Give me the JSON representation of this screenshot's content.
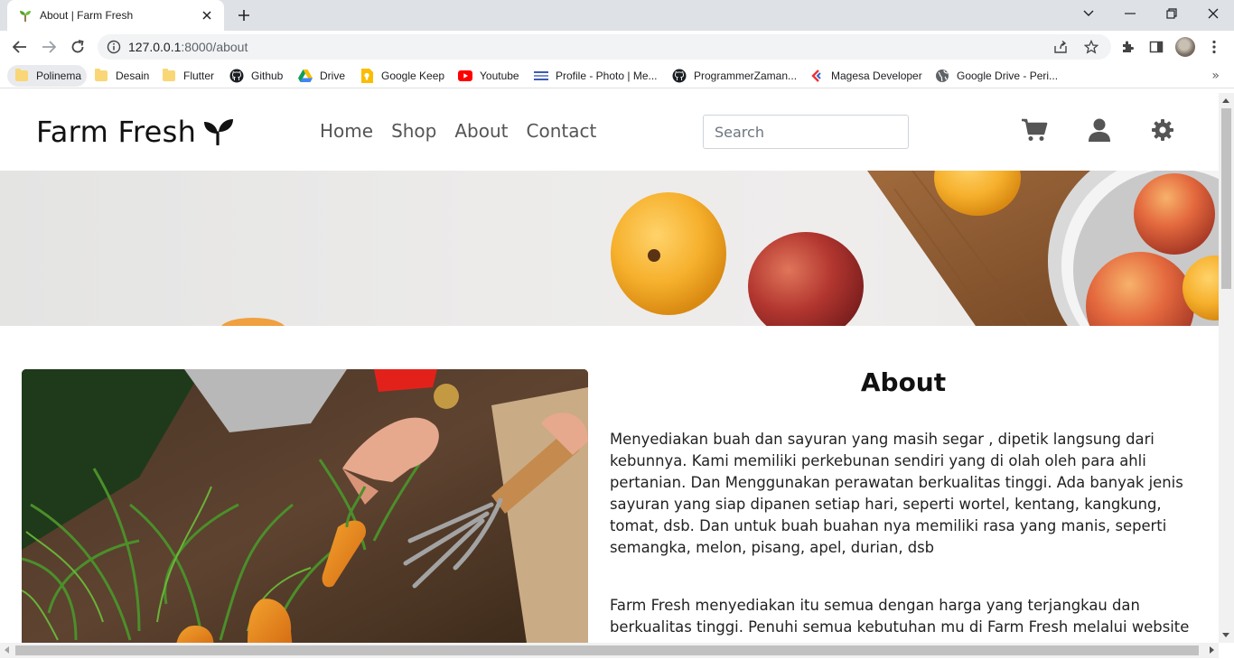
{
  "browser": {
    "tab_title": "About | Farm Fresh",
    "url_host": "127.0.0.1",
    "url_rest": ":8000/about",
    "bookmarks": [
      {
        "label": "Polinema",
        "icon": "folder-icon"
      },
      {
        "label": "Desain",
        "icon": "folder-icon"
      },
      {
        "label": "Flutter",
        "icon": "folder-icon"
      },
      {
        "label": "Github",
        "icon": "github-icon"
      },
      {
        "label": "Drive",
        "icon": "google-drive-icon"
      },
      {
        "label": "Google Keep",
        "icon": "google-keep-icon"
      },
      {
        "label": "Youtube",
        "icon": "youtube-icon"
      },
      {
        "label": "Profile - Photo | Me...",
        "icon": "profile-site-icon"
      },
      {
        "label": "ProgrammerZaman...",
        "icon": "github-icon"
      },
      {
        "label": "Magesa Developer",
        "icon": "magesa-icon"
      },
      {
        "label": "Google Drive - Peri...",
        "icon": "globe-icon"
      }
    ],
    "more_bookmarks": "»"
  },
  "site": {
    "logo_text": "Farm Fresh",
    "nav": [
      "Home",
      "Shop",
      "About",
      "Contact"
    ],
    "search_placeholder": "Search"
  },
  "about": {
    "title": "About",
    "paragraph1": "Menyediakan buah dan sayuran yang masih segar , dipetik langsung dari kebunnya. Kami memiliki perkebunan sendiri yang di olah oleh para ahli pertanian. Dan Menggunakan perawatan berkualitas tinggi. Ada banyak jenis sayuran yang siap dipanen setiap hari, seperti wortel, kentang, kangkung, tomat, dsb. Dan untuk buah buahan nya memiliki rasa yang manis, seperti semangka, melon, pisang, apel, durian, dsb",
    "paragraph2": "Farm Fresh menyediakan itu semua dengan harga yang terjangkau dan berkualitas tinggi. Penuhi semua kebutuhan mu di Farm Fresh melalui website"
  }
}
